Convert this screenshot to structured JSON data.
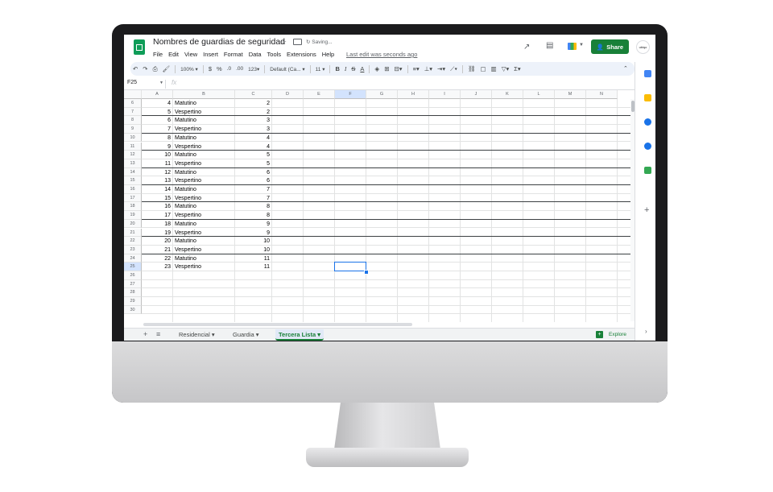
{
  "header": {
    "title": "Nombres de guardias de seguridad",
    "saving": "Saving...",
    "last_edit": "Last edit was seconds ago",
    "share_label": "Share",
    "avatar_text": "ubiqo",
    "menu": [
      "File",
      "Edit",
      "View",
      "Insert",
      "Format",
      "Data",
      "Tools",
      "Extensions",
      "Help"
    ]
  },
  "toolbar": {
    "zoom": "100%",
    "currency": "$",
    "percent": "%",
    "dec_decrease": ".0",
    "dec_increase": ".00",
    "more_formats": "123",
    "font": "Default (Ca...",
    "font_size": "11",
    "bold": "B",
    "italic": "I",
    "strike": "S",
    "text_color": "A"
  },
  "namebox": "F25",
  "fx": "fx",
  "columns": [
    "A",
    "B",
    "C",
    "D",
    "E",
    "F",
    "G",
    "H",
    "I",
    "J",
    "K",
    "L",
    "M",
    "N"
  ],
  "rows": [
    {
      "n": "6",
      "a": "4",
      "b": "Matutino",
      "c": "2"
    },
    {
      "n": "7",
      "a": "5",
      "b": "Vespertino",
      "c": "2"
    },
    {
      "n": "8",
      "a": "6",
      "b": "Matutino",
      "c": "3"
    },
    {
      "n": "9",
      "a": "7",
      "b": "Vespertino",
      "c": "3"
    },
    {
      "n": "10",
      "a": "8",
      "b": "Matutino",
      "c": "4"
    },
    {
      "n": "11",
      "a": "9",
      "b": "Vespertino",
      "c": "4"
    },
    {
      "n": "12",
      "a": "10",
      "b": "Matutino",
      "c": "5"
    },
    {
      "n": "13",
      "a": "11",
      "b": "Vespertino",
      "c": "5"
    },
    {
      "n": "14",
      "a": "12",
      "b": "Matutino",
      "c": "6"
    },
    {
      "n": "15",
      "a": "13",
      "b": "Vespertino",
      "c": "6"
    },
    {
      "n": "16",
      "a": "14",
      "b": "Matutino",
      "c": "7"
    },
    {
      "n": "17",
      "a": "15",
      "b": "Vespertino",
      "c": "7"
    },
    {
      "n": "18",
      "a": "16",
      "b": "Matutino",
      "c": "8"
    },
    {
      "n": "19",
      "a": "17",
      "b": "Vespertino",
      "c": "8"
    },
    {
      "n": "20",
      "a": "18",
      "b": "Matutino",
      "c": "9"
    },
    {
      "n": "21",
      "a": "19",
      "b": "Vespertino",
      "c": "9"
    },
    {
      "n": "22",
      "a": "20",
      "b": "Matutino",
      "c": "10"
    },
    {
      "n": "23",
      "a": "21",
      "b": "Vespertino",
      "c": "10"
    },
    {
      "n": "24",
      "a": "22",
      "b": "Matutino",
      "c": "11"
    },
    {
      "n": "25",
      "a": "23",
      "b": "Vespertino",
      "c": "11"
    },
    {
      "n": "26",
      "a": "",
      "b": "",
      "c": ""
    },
    {
      "n": "27",
      "a": "",
      "b": "",
      "c": ""
    },
    {
      "n": "28",
      "a": "",
      "b": "",
      "c": ""
    },
    {
      "n": "29",
      "a": "",
      "b": "",
      "c": ""
    },
    {
      "n": "30",
      "a": "",
      "b": "",
      "c": ""
    }
  ],
  "selected_cell": "F25",
  "sheets": [
    "Residencial",
    "Guardia",
    "Tercera Lista"
  ],
  "active_sheet": "Tercera Lista",
  "explore_label": "Explore",
  "side_panel": [
    {
      "name": "calendar",
      "color": "#4285f4"
    },
    {
      "name": "keep",
      "color": "#fbbc04"
    },
    {
      "name": "tasks",
      "color": "#1a73e8"
    },
    {
      "name": "contacts",
      "color": "#1a73e8"
    },
    {
      "name": "maps",
      "color": "#34a853"
    }
  ],
  "colors": {
    "brand_green": "#188038",
    "selection_blue": "#1a73e8"
  }
}
